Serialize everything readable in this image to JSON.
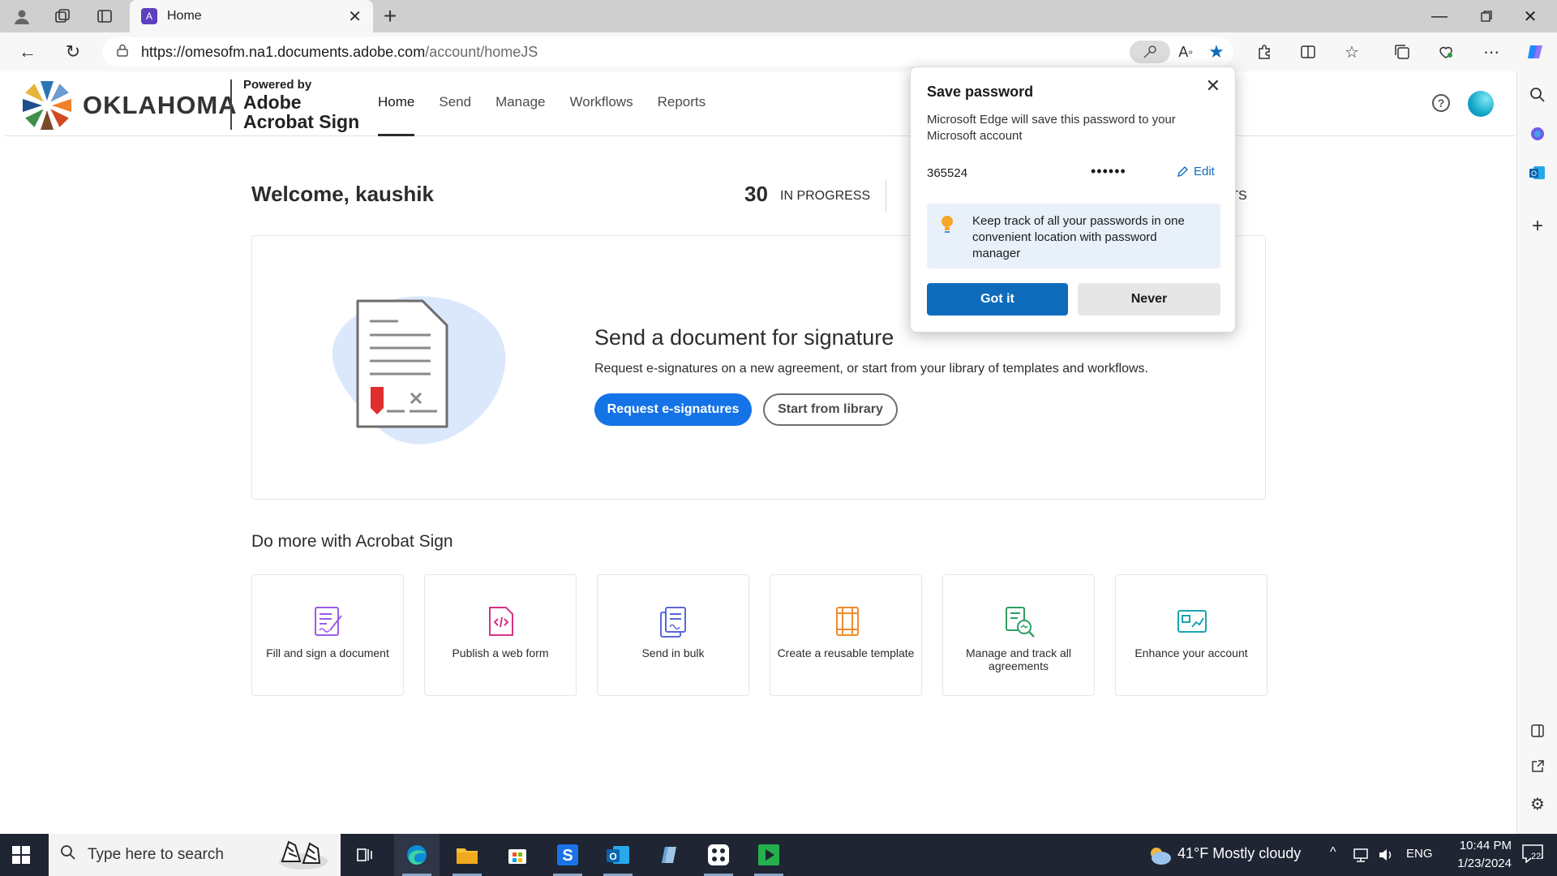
{
  "browser": {
    "tab": {
      "title": "Home"
    },
    "url": {
      "host": "https://omesofm.na1.documents.adobe.com",
      "path": "/account/homeJS"
    }
  },
  "header": {
    "logo_text": "OKLAHOMA",
    "powered_by": "Powered by",
    "adobe_line1": "Adobe",
    "adobe_line2": "Acrobat Sign",
    "nav": [
      {
        "label": "Home",
        "active": true
      },
      {
        "label": "Send"
      },
      {
        "label": "Manage"
      },
      {
        "label": "Workflows"
      },
      {
        "label": "Reports"
      }
    ]
  },
  "main": {
    "welcome": "Welcome, kaushik",
    "in_progress_count": "30",
    "in_progress_label": "IN PROGRESS",
    "reports_tail": "RTS",
    "send_card": {
      "title": "Send a document for signature",
      "subtitle": "Request e-signatures on a new agreement, or start from your library of templates and workflows.",
      "primary_button": "Request e-signatures",
      "secondary_button": "Start from library"
    },
    "do_more_title": "Do more with Acrobat Sign",
    "features": [
      {
        "label": "Fill and sign a document",
        "icon": "fill-sign-icon",
        "color": "#9b5de5"
      },
      {
        "label": "Publish a web form",
        "icon": "web-form-icon",
        "color": "#d63384"
      },
      {
        "label": "Send in bulk",
        "icon": "send-bulk-icon",
        "color": "#5a67d8"
      },
      {
        "label": "Create a reusable template",
        "icon": "template-icon",
        "color": "#f08c2e"
      },
      {
        "label": "Manage and track all agreements",
        "icon": "manage-track-icon",
        "color": "#2f9e64"
      },
      {
        "label": "Enhance your account",
        "icon": "enhance-account-icon",
        "color": "#1ba3b0"
      }
    ]
  },
  "password_popup": {
    "title": "Save password",
    "description": "Microsoft Edge will save this password to your Microsoft account",
    "username": "365524",
    "password_mask": "••••••",
    "edit_label": "Edit",
    "tip": "Keep track of all your passwords in one convenient location with password manager",
    "got_it": "Got it",
    "never": "Never"
  },
  "taskbar": {
    "search_placeholder": "Type here to search",
    "weather": "41°F  Mostly cloudy",
    "language": "ENG",
    "time": "10:44 PM",
    "date": "1/23/2024",
    "notifications": "22"
  },
  "colors": {
    "accent_blue": "#1473e6",
    "edge_blue": "#0f6cbd",
    "taskbar": "#1f2533"
  }
}
